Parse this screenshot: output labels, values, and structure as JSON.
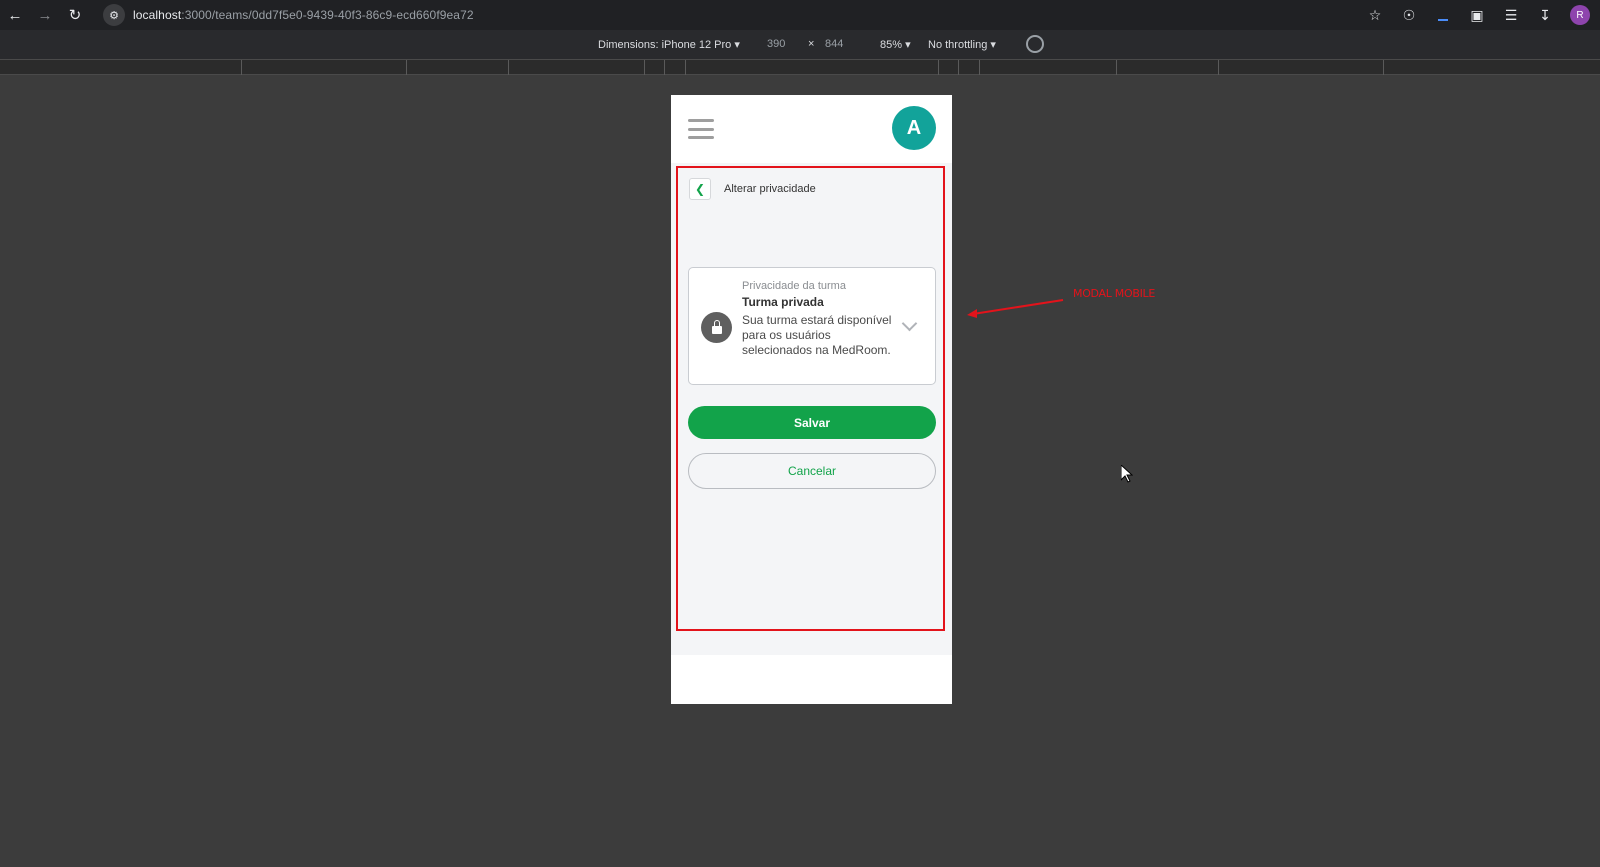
{
  "browser": {
    "url_host": "localhost",
    "url_path": ":3000/teams/0dd7f5e0-9439-40f3-86c9-ecd660f9ea72",
    "profile_initial": "R"
  },
  "device_toolbar": {
    "dimensions_label": "Dimensions: iPhone 12 Pro ▾",
    "width": "390",
    "times": "×",
    "height": "844",
    "zoom": "85% ▾",
    "throttling": "No throttling ▾"
  },
  "app": {
    "avatar_initial": "A"
  },
  "modal": {
    "title": "Alterar privacidade",
    "privacy_card": {
      "label": "Privacidade da turma",
      "value": "Turma privada",
      "description": "Sua turma estará disponível para os usuários selecionados na MedRoom."
    },
    "save_label": "Salvar",
    "cancel_label": "Cancelar"
  },
  "annotation": {
    "label": "MODAL MOBILE",
    "color": "#e3131b"
  },
  "colors": {
    "primary_green": "#12a34a",
    "avatar_teal": "#12a39a"
  }
}
